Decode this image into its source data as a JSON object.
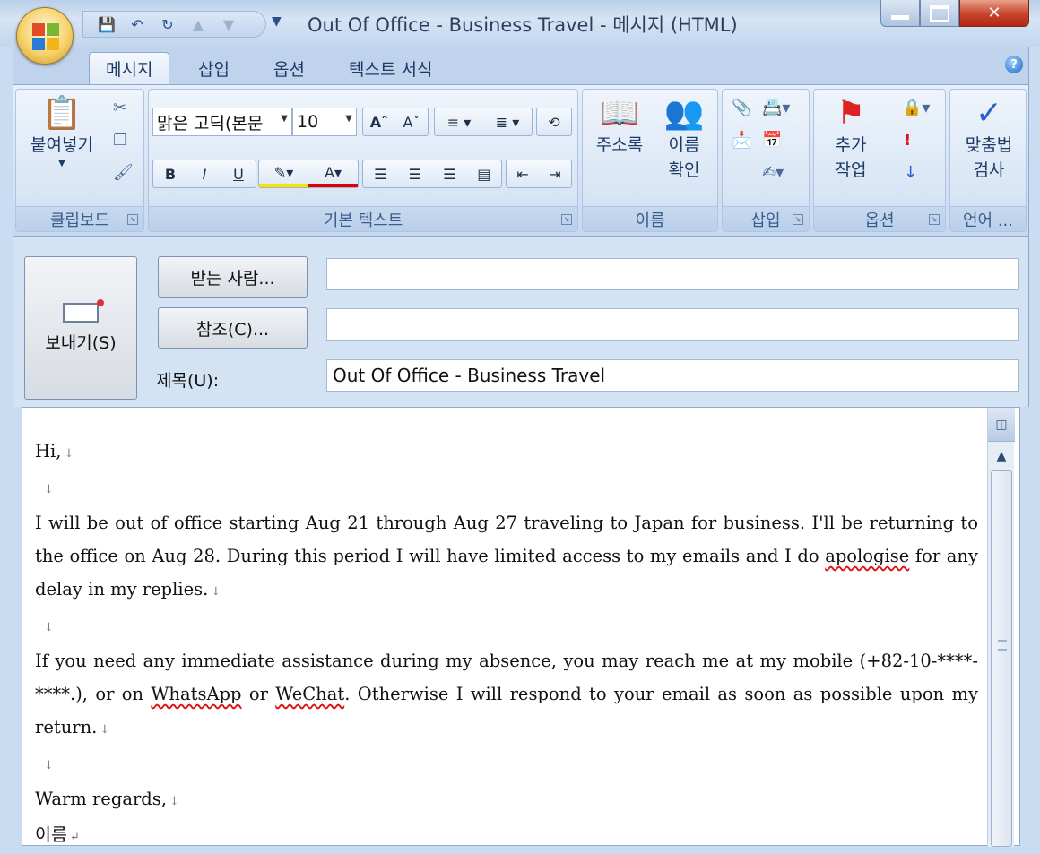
{
  "window": {
    "title": "Out Of Office - Business Travel - 메시지 (HTML)"
  },
  "ribbon": {
    "tabs": [
      "메시지",
      "삽입",
      "옵션",
      "텍스트 서식"
    ],
    "groups": {
      "clipboard": {
        "label": "클립보드",
        "paste_label": "붙여넣기"
      },
      "basic_text": {
        "label": "기본 텍스트",
        "font_name": "맑은 고딕(본문",
        "font_size": "10"
      },
      "names": {
        "label": "이름",
        "address_book_label": "주소록",
        "check_names_line1": "이름",
        "check_names_line2": "확인"
      },
      "insert": {
        "label": "삽입"
      },
      "options": {
        "label": "옵션",
        "follow_up_line1": "추가",
        "follow_up_line2": "작업"
      },
      "language": {
        "label": "언어 ...",
        "spelling_line1": "맞춤법",
        "spelling_line2": "검사"
      }
    }
  },
  "header": {
    "send_label": "보내기(S)",
    "to_button": "받는 사람...",
    "cc_button": "참조(C)...",
    "subject_label": "제목(U):",
    "to_value": "",
    "cc_value": "",
    "subject_value": "Out Of Office - Business Travel"
  },
  "message": {
    "greeting": "Hi,",
    "p1_a": "I will be out of office starting Aug 21 through Aug 27 traveling to Japan for business. I'll be returning to the office on Aug 28. During this period I will have limited access to my emails and I do ",
    "p1_b": "apologise",
    "p1_c": " for any delay in my replies.",
    "p2_a": "If you need any immediate assistance during my absence, you may reach me at my mobile (+82-10-****-****.), or on ",
    "p2_b": "WhatsApp",
    "p2_c": " or ",
    "p2_d": "WeChat",
    "p2_e": ". Otherwise I will respond to your email as soon as possible upon my return.",
    "closing": "Warm regards,",
    "signature": "이름"
  }
}
